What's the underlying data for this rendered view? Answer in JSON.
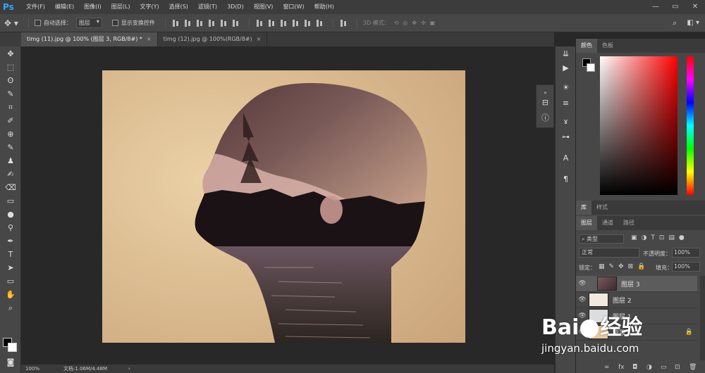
{
  "app": {
    "logo": "Ps"
  },
  "menu": [
    "文件(F)",
    "编辑(E)",
    "图像(I)",
    "图层(L)",
    "文字(Y)",
    "选择(S)",
    "滤镜(T)",
    "3D(D)",
    "视图(V)",
    "窗口(W)",
    "帮助(H)"
  ],
  "window_buttons": [
    "—",
    "▭",
    "✕"
  ],
  "options": {
    "auto_select_label": "自动选择：",
    "auto_select_value": "图层",
    "show_transform_label": "显示变换控件",
    "mode3d_label": "3D 模式："
  },
  "tabs": [
    {
      "label": "timg (11).jpg @ 100% (图层 3, RGB/8#) *",
      "close": "×"
    },
    {
      "label": "timg (12).jpg @ 100%(RGB/8#)",
      "close": "×"
    }
  ],
  "status": {
    "zoom": "100%",
    "doc": "文档:1.06M/4.48M",
    "arrow": "›"
  },
  "color_panel": {
    "tabs": [
      "颜色",
      "色板"
    ]
  },
  "lib_panel": {
    "tabs": [
      "库",
      "样式"
    ]
  },
  "layers_panel": {
    "tabs": [
      "图层",
      "通道",
      "路径"
    ],
    "filter_label": "类型",
    "blend_mode": "正常",
    "opacity_label": "不透明度：",
    "opacity": "100%",
    "lock_label": "锁定：",
    "fill_label": "填充：",
    "fill": "100%",
    "layers": [
      {
        "name": "图层 3"
      },
      {
        "name": "图层 2"
      },
      {
        "name": "图层 1"
      },
      {
        "name": "背景"
      }
    ],
    "bottom_icons": [
      "∞",
      "fx",
      "◘",
      "◑",
      "▭",
      "⊡",
      "🗑"
    ]
  },
  "watermark": {
    "brand": "Bai",
    "brand2": "经验",
    "url": "jingyan.baidu.com"
  },
  "colors": {
    "accent": "#31a8ff",
    "panel": "#474747",
    "bg": "#282828"
  }
}
